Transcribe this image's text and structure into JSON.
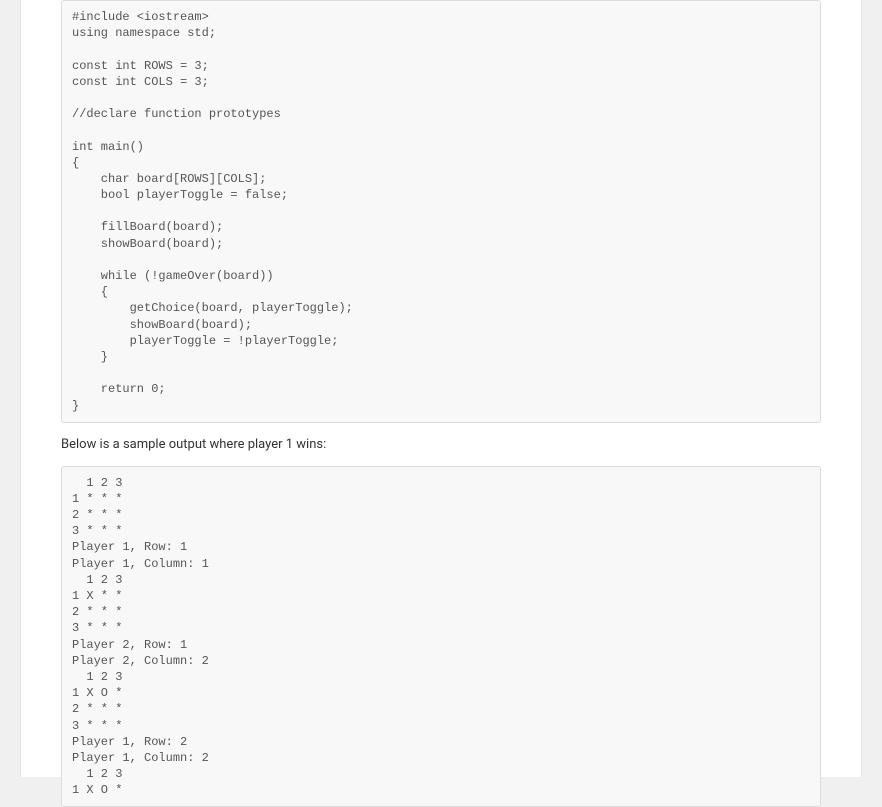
{
  "code_block_1": "#include <iostream>\nusing namespace std;\n\nconst int ROWS = 3;\nconst int COLS = 3;\n\n//declare function prototypes\n\nint main()\n{\n    char board[ROWS][COLS];\n    bool playerToggle = false;\n\n    fillBoard(board);\n    showBoard(board);\n\n    while (!gameOver(board))\n    {\n        getChoice(board, playerToggle);\n        showBoard(board);\n        playerToggle = !playerToggle;\n    }\n\n    return 0;\n}",
  "description_1": "Below is a sample output where player 1 wins:",
  "code_block_2": "  1 2 3\n1 * * *\n2 * * *\n3 * * *\nPlayer 1, Row: 1\nPlayer 1, Column: 1\n  1 2 3\n1 X * *\n2 * * *\n3 * * *\nPlayer 2, Row: 1\nPlayer 2, Column: 2\n  1 2 3\n1 X O *\n2 * * *\n3 * * *\nPlayer 1, Row: 2\nPlayer 1, Column: 2\n  1 2 3\n1 X O *"
}
